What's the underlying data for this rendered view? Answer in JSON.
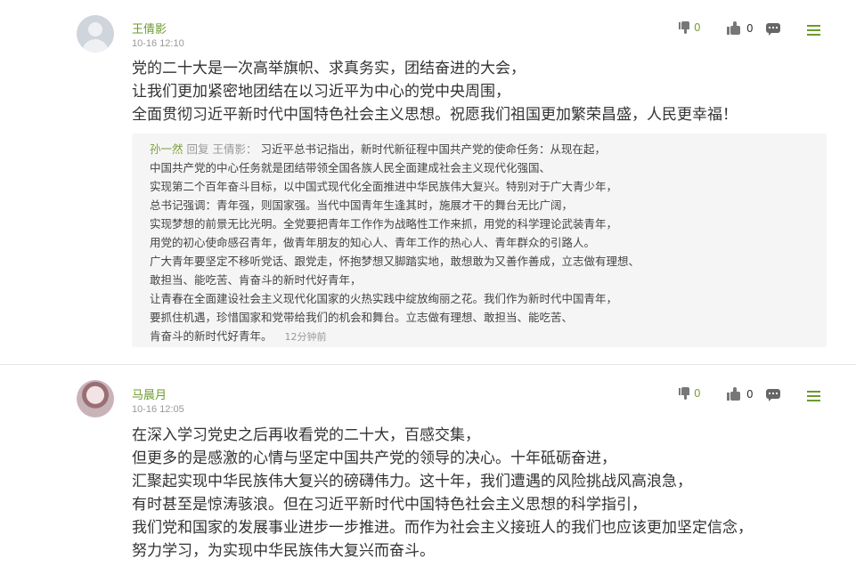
{
  "comments": [
    {
      "username": "王倩影",
      "time": "10-16 12:10",
      "downvotes": "0",
      "upvotes": "0",
      "lines": [
        "党的二十大是一次高举旗帜、求真务实，团结奋进的大会，",
        "让我们更加紧密地团结在以习近平为中心的党中央周围，",
        "全面贯彻习近平新时代中国特色社会主义思想。祝愿我们祖国更加繁荣昌盛，人民更幸福！"
      ],
      "reply": {
        "author": "孙一然",
        "reply_word": "回复",
        "target": "王倩影：",
        "lines": [
          "习近平总书记指出，新时代新征程中国共产党的使命任务：从现在起，",
          "中国共产党的中心任务就是团结带领全国各族人民全面建成社会主义现代化强国、",
          "实现第二个百年奋斗目标，以中国式现代化全面推进中华民族伟大复兴。特别对于广大青少年，",
          "总书记强调：青年强，则国家强。当代中国青年生逢其时，施展才干的舞台无比广阔，",
          "实现梦想的前景无比光明。全党要把青年工作作为战略性工作来抓，用党的科学理论武装青年，",
          "用党的初心使命感召青年，做青年朋友的知心人、青年工作的热心人、青年群众的引路人。",
          "广大青年要坚定不移听党话、跟党走，怀抱梦想又脚踏实地，敢想敢为又善作善成，立志做有理想、",
          "敢担当、能吃苦、肯奋斗的新时代好青年，",
          "让青春在全面建设社会主义现代化国家的火热实践中绽放绚丽之花。我们作为新时代中国青年，",
          "要抓住机遇，珍惜国家和党带给我们的机会和舞台。立志做有理想、敢担当、能吃苦、",
          "肯奋斗的新时代好青年。"
        ],
        "time": "12分钟前"
      }
    },
    {
      "username": "马晨月",
      "time": "10-16 12:05",
      "downvotes": "0",
      "upvotes": "0",
      "lines": [
        "在深入学习党史之后再收看党的二十大，百感交集，",
        "但更多的是感激的心情与坚定中国共产党的领导的决心。十年砥砺奋进，",
        "汇聚起实现中华民族伟大复兴的磅礴伟力。这十年，我们遭遇的风险挑战风高浪急，",
        "有时甚至是惊涛骇浪。但在习近平新时代中国特色社会主义思想的科学指引，",
        "我们党和国家的发展事业进步一步推进。而作为社会主义接班人的我们也应该更加坚定信念，",
        "努力学习，为实现中华民族伟大复兴而奋斗。"
      ]
    }
  ]
}
